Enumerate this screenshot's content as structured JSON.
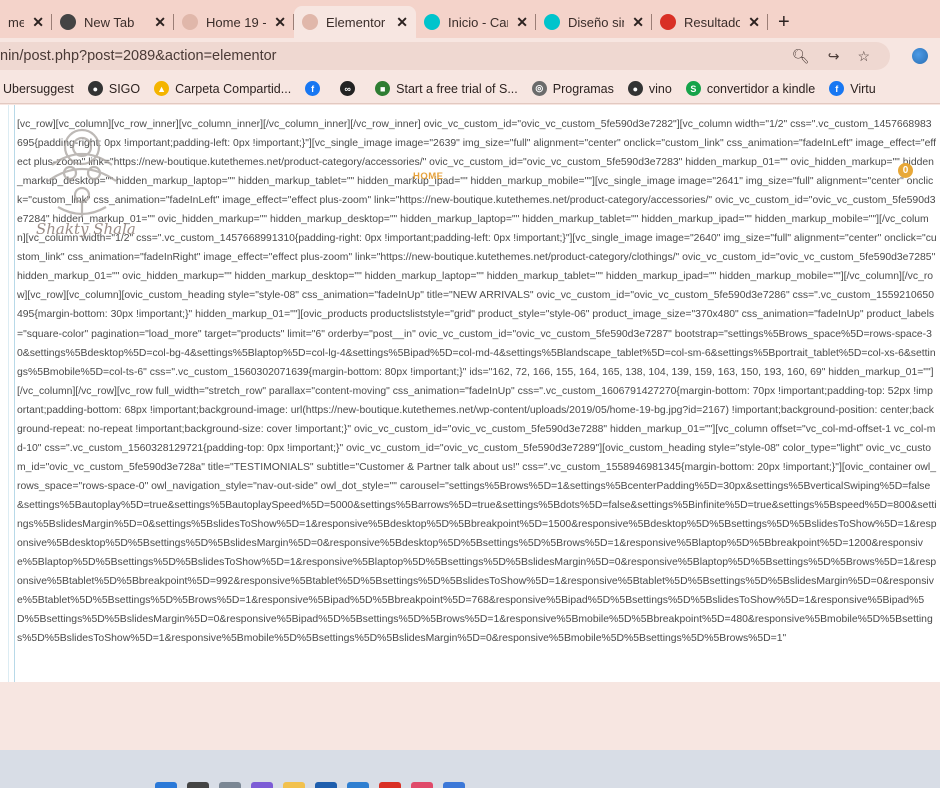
{
  "browser": {
    "tabs": [
      {
        "title": "me",
        "favicon": "partial-tab",
        "color": "#9b7e76",
        "active": false
      },
      {
        "title": "New Tab",
        "favicon": "chrome-icon",
        "color": "#444444",
        "active": false
      },
      {
        "title": "Home 19 -",
        "favicon": "site-icon",
        "color": "#e0b7aa",
        "active": false
      },
      {
        "title": "Elementor",
        "favicon": "site-icon",
        "color": "#e0b7aa",
        "active": true
      },
      {
        "title": "Inicio - Car",
        "favicon": "canva-icon",
        "color": "#00c4cc",
        "active": false
      },
      {
        "title": "Diseño sin",
        "favicon": "canva-icon",
        "color": "#00c4cc",
        "active": false
      },
      {
        "title": "Resultados",
        "favicon": "gmail-icon",
        "color": "#d93025",
        "active": false
      }
    ],
    "new_tab_label": "+",
    "address": "nin/post.php?post=2089&action=elementor",
    "bookmarks": [
      {
        "label": "Ubersuggest",
        "icon": "none"
      },
      {
        "label": "SIGO",
        "icon": "chrome-icon",
        "color": "#333333"
      },
      {
        "label": "Carpeta Compartid...",
        "icon": "drive-icon",
        "color": "#f4b400"
      },
      {
        "label": "",
        "icon": "facebook-icon",
        "color": "#1877f2"
      },
      {
        "label": "",
        "icon": "glasses-icon",
        "color": "#222222"
      },
      {
        "label": "Start a free trial of S...",
        "icon": "green-flag-icon",
        "color": "#2e7d32"
      },
      {
        "label": "Programas",
        "icon": "globe-icon",
        "color": "#6b6b6b"
      },
      {
        "label": "vino",
        "icon": "chrome-icon",
        "color": "#333333"
      },
      {
        "label": "convertidor a kindle",
        "icon": "s-icon",
        "color": "#16a34a"
      },
      {
        "label": "Virtu",
        "icon": "facebook-icon",
        "color": "#1877f2"
      }
    ]
  },
  "page": {
    "watermark_text": "Shakty Shala",
    "home_label": "HOME",
    "badge_count": "0",
    "code_text": "[vc_row][vc_column][vc_row_inner][vc_column_inner][/vc_column_inner][/vc_row_inner] ovic_vc_custom_id=\"ovic_vc_custom_5fe590d3e7282\"][vc_column width=\"1/2\" css=\".vc_custom_1457668983695{padding-right: 0px !important;padding-left: 0px !important;}\"][vc_single_image image=\"2639\" img_size=\"full\" alignment=\"center\" onclick=\"custom_link\" css_animation=\"fadeInLeft\" image_effect=\"effect plus-zoom\" link=\"https://new-boutique.kutethemes.net/product-category/accessories/\" ovic_vc_custom_id=\"ovic_vc_custom_5fe590d3e7283\" hidden_markup_01=\"\" ovic_hidden_markup=\"\" hidden_markup_desktop=\"\" hidden_markup_laptop=\"\" hidden_markup_tablet=\"\" hidden_markup_ipad=\"\" hidden_markup_mobile=\"\"][vc_single_image image=\"2641\" img_size=\"full\" alignment=\"center\" onclick=\"custom_link\" css_animation=\"fadeInLeft\" image_effect=\"effect plus-zoom\" link=\"https://new-boutique.kutethemes.net/product-category/accessories/\" ovic_vc_custom_id=\"ovic_vc_custom_5fe590d3e7284\" hidden_markup_01=\"\" ovic_hidden_markup=\"\" hidden_markup_desktop=\"\" hidden_markup_laptop=\"\" hidden_markup_tablet=\"\" hidden_markup_ipad=\"\" hidden_markup_mobile=\"\"][/vc_column][vc_column width=\"1/2\" css=\".vc_custom_1457668991310{padding-right: 0px !important;padding-left: 0px !important;}\"][vc_single_image image=\"2640\" img_size=\"full\" alignment=\"center\" onclick=\"custom_link\" css_animation=\"fadeInRight\" image_effect=\"effect plus-zoom\" link=\"https://new-boutique.kutethemes.net/product-category/clothings/\" ovic_vc_custom_id=\"ovic_vc_custom_5fe590d3e7285\" hidden_markup_01=\"\" ovic_hidden_markup=\"\" hidden_markup_desktop=\"\" hidden_markup_laptop=\"\" hidden_markup_tablet=\"\" hidden_markup_ipad=\"\" hidden_markup_mobile=\"\"][/vc_column][/vc_row][vc_row][vc_column][ovic_custom_heading style=\"style-08\" css_animation=\"fadeInUp\" title=\"NEW ARRIVALS\" ovic_vc_custom_id=\"ovic_vc_custom_5fe590d3e7286\" css=\".vc_custom_1559210650495{margin-bottom: 30px !important;}\" hidden_markup_01=\"\"][ovic_products productsliststyle=\"grid\" product_style=\"style-06\" product_image_size=\"370x480\" css_animation=\"fadeInUp\" product_labels=\"square-color\" pagination=\"load_more\" target=\"products\" limit=\"6\" orderby=\"post__in\" ovic_vc_custom_id=\"ovic_vc_custom_5fe590d3e7287\" bootstrap=\"settings%5Brows_space%5D=rows-space-30&settings%5Bdesktop%5D=col-bg-4&settings%5Blaptop%5D=col-lg-4&settings%5Bipad%5D=col-md-4&settings%5Blandscape_tablet%5D=col-sm-6&settings%5Bportrait_tablet%5D=col-xs-6&settings%5Bmobile%5D=col-ts-6\" css=\".vc_custom_1560302071639{margin-bottom: 80px !important;}\" ids=\"162, 72, 166, 155, 164, 165, 138, 104, 139, 159, 163, 150, 193, 160, 69\" hidden_markup_01=\"\"][/vc_column][/vc_row][vc_row full_width=\"stretch_row\" parallax=\"content-moving\" css_animation=\"fadeInUp\" css=\".vc_custom_1606791427270{margin-bottom: 70px !important;padding-top: 52px !important;padding-bottom: 68px !important;background-image: url(https://new-boutique.kutethemes.net/wp-content/uploads/2019/05/home-19-bg.jpg?id=2167) !important;background-position: center;background-repeat: no-repeat !important;background-size: cover !important;}\" ovic_vc_custom_id=\"ovic_vc_custom_5fe590d3e7288\" hidden_markup_01=\"\"][vc_column offset=\"vc_col-md-offset-1 vc_col-md-10\" css=\".vc_custom_1560328129721{padding-top: 0px !important;}\" ovic_vc_custom_id=\"ovic_vc_custom_5fe590d3e7289\"][ovic_custom_heading style=\"style-08\" color_type=\"light\" ovic_vc_custom_id=\"ovic_vc_custom_5fe590d3e728a\" title=\"TESTIMONIALS\" subtitle=\"Customer & Partner talk about us!\" css=\".vc_custom_1558946981345{margin-bottom: 20px !important;}\"][ovic_container owl_rows_space=\"rows-space-0\" owl_navigation_style=\"nav-out-side\" owl_dot_style=\"\" carousel=\"settings%5Brows%5D=1&settings%5BcenterPadding%5D=30px&settings%5BverticalSwiping%5D=false&settings%5Bautoplay%5D=true&settings%5BautoplaySpeed%5D=5000&settings%5Barrows%5D=true&settings%5Bdots%5D=false&settings%5Binfinite%5D=true&settings%5Bspeed%5D=800&settings%5BslidesMargin%5D=0&settings%5BslidesToShow%5D=1&responsive%5Bdesktop%5D%5Bbreakpoint%5D=1500&responsive%5Bdesktop%5D%5Bsettings%5D%5BslidesToShow%5D=1&responsive%5Bdesktop%5D%5Bsettings%5D%5BslidesMargin%5D=0&responsive%5Bdesktop%5D%5Bsettings%5D%5Brows%5D=1&responsive%5Blaptop%5D%5Bbreakpoint%5D=1200&responsive%5Blaptop%5D%5Bsettings%5D%5BslidesToShow%5D=1&responsive%5Blaptop%5D%5Bsettings%5D%5BslidesMargin%5D=0&responsive%5Blaptop%5D%5Bsettings%5D%5Brows%5D=1&responsive%5Btablet%5D%5Bbreakpoint%5D=992&responsive%5Btablet%5D%5Bsettings%5D%5BslidesToShow%5D=1&responsive%5Btablet%5D%5Bsettings%5D%5BslidesMargin%5D=0&responsive%5Btablet%5D%5Bsettings%5D%5Brows%5D=1&responsive%5Bipad%5D%5Bbreakpoint%5D=768&responsive%5Bipad%5D%5Bsettings%5D%5BslidesToShow%5D=1&responsive%5Bipad%5D%5Bsettings%5D%5BslidesMargin%5D=0&responsive%5Bipad%5D%5Bsettings%5D%5Brows%5D=1&responsive%5Bmobile%5D%5Bbreakpoint%5D=480&responsive%5Bmobile%5D%5Bsettings%5D%5BslidesToShow%5D=1&responsive%5Bmobile%5D%5Bsettings%5D%5BslidesMargin%5D=0&responsive%5Bmobile%5D%5Bsettings%5D%5Brows%5D=1\""
  },
  "taskbar": {
    "icons": [
      {
        "name": "windows-start-icon",
        "color": "#2b79d8"
      },
      {
        "name": "search-icon",
        "color": "#444444"
      },
      {
        "name": "widgets-icon",
        "color": "#7b8794"
      },
      {
        "name": "edge-icon",
        "color": "#7d5cd6"
      },
      {
        "name": "explorer-icon",
        "color": "#f2c14e"
      },
      {
        "name": "store-icon",
        "color": "#1f5fae"
      },
      {
        "name": "mail-icon",
        "color": "#2f7fd1"
      },
      {
        "name": "chrome-icon",
        "color": "#d93025"
      },
      {
        "name": "app-icon",
        "color": "#e04a6a"
      },
      {
        "name": "notepad-icon",
        "color": "#3c78d8"
      }
    ]
  }
}
